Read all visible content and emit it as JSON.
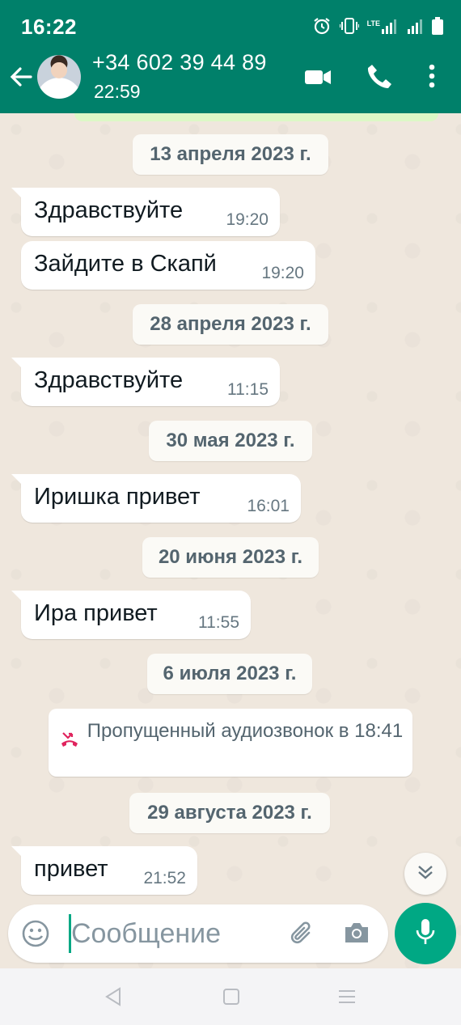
{
  "status_bar": {
    "time": "16:22",
    "network_label": "LTE",
    "icons": [
      "alarm-icon",
      "vibrate-icon",
      "signal-icon",
      "signal-icon",
      "battery-icon"
    ]
  },
  "header": {
    "contact_name": "+34 602 39 44 89",
    "subtitle": "22:59",
    "icons": [
      "back-arrow-icon",
      "video-call-icon",
      "phone-icon",
      "more-vertical-icon"
    ],
    "bg_color": "#00806a"
  },
  "chat": {
    "messages": [
      {
        "type": "date",
        "text": "13 апреля 2023 г."
      },
      {
        "type": "incoming",
        "text": "Здравствуйте",
        "time": "19:20"
      },
      {
        "type": "incoming",
        "text": "Зайдите в Скапй",
        "time": "19:20"
      },
      {
        "type": "date",
        "text": "28 апреля 2023 г."
      },
      {
        "type": "incoming",
        "text": "Здравствуйте",
        "time": "11:15"
      },
      {
        "type": "date",
        "text": "30 мая 2023 г."
      },
      {
        "type": "incoming",
        "text": "Иришка привет",
        "time": "16:01"
      },
      {
        "type": "date",
        "text": "20 июня 2023 г."
      },
      {
        "type": "incoming",
        "text": "Ира привет",
        "time": "11:55"
      },
      {
        "type": "date",
        "text": "6 июля 2023 г."
      },
      {
        "type": "missed_call",
        "text": "Пропущенный аудиозвонок в 18:41"
      },
      {
        "type": "date",
        "text": "29 августа 2023 г."
      },
      {
        "type": "incoming",
        "text": "привет",
        "time": "21:52"
      }
    ]
  },
  "composer": {
    "placeholder": "Сообщение",
    "value": "",
    "icons": [
      "emoji-icon",
      "attach-icon",
      "camera-icon",
      "mic-icon"
    ],
    "accent_color": "#00a884"
  },
  "navbar": {
    "icons": [
      "nav-back-icon",
      "nav-home-icon",
      "nav-menu-icon"
    ]
  }
}
